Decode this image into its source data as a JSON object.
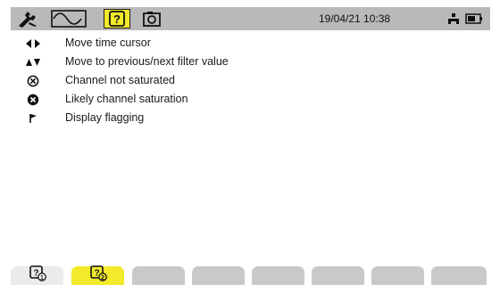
{
  "topbar": {
    "datetime": "19/04/21 10:38",
    "icons": [
      "wrench-icon",
      "waveform-icon",
      "help-icon",
      "camera-icon",
      "network-icon",
      "battery-icon"
    ]
  },
  "help_items": [
    {
      "icon": "left-right-arrows-icon",
      "text": "Move time cursor"
    },
    {
      "icon": "up-down-arrows-icon",
      "text": "Move to previous/next filter value"
    },
    {
      "icon": "channel-not-saturated-icon",
      "text": "Channel not saturated"
    },
    {
      "icon": "channel-saturation-icon",
      "text": "Likely channel saturation"
    },
    {
      "icon": "flag-icon",
      "text": "Display flagging"
    }
  ],
  "bottom_tabs": [
    {
      "icon": "help-page-1-icon",
      "active": false
    },
    {
      "icon": "help-page-2-icon",
      "active": true
    }
  ],
  "colors": {
    "accent_yellow": "#f2ea2a",
    "bar_gray": "#b9b9b9",
    "tab_gray": "#c9c9c9"
  }
}
